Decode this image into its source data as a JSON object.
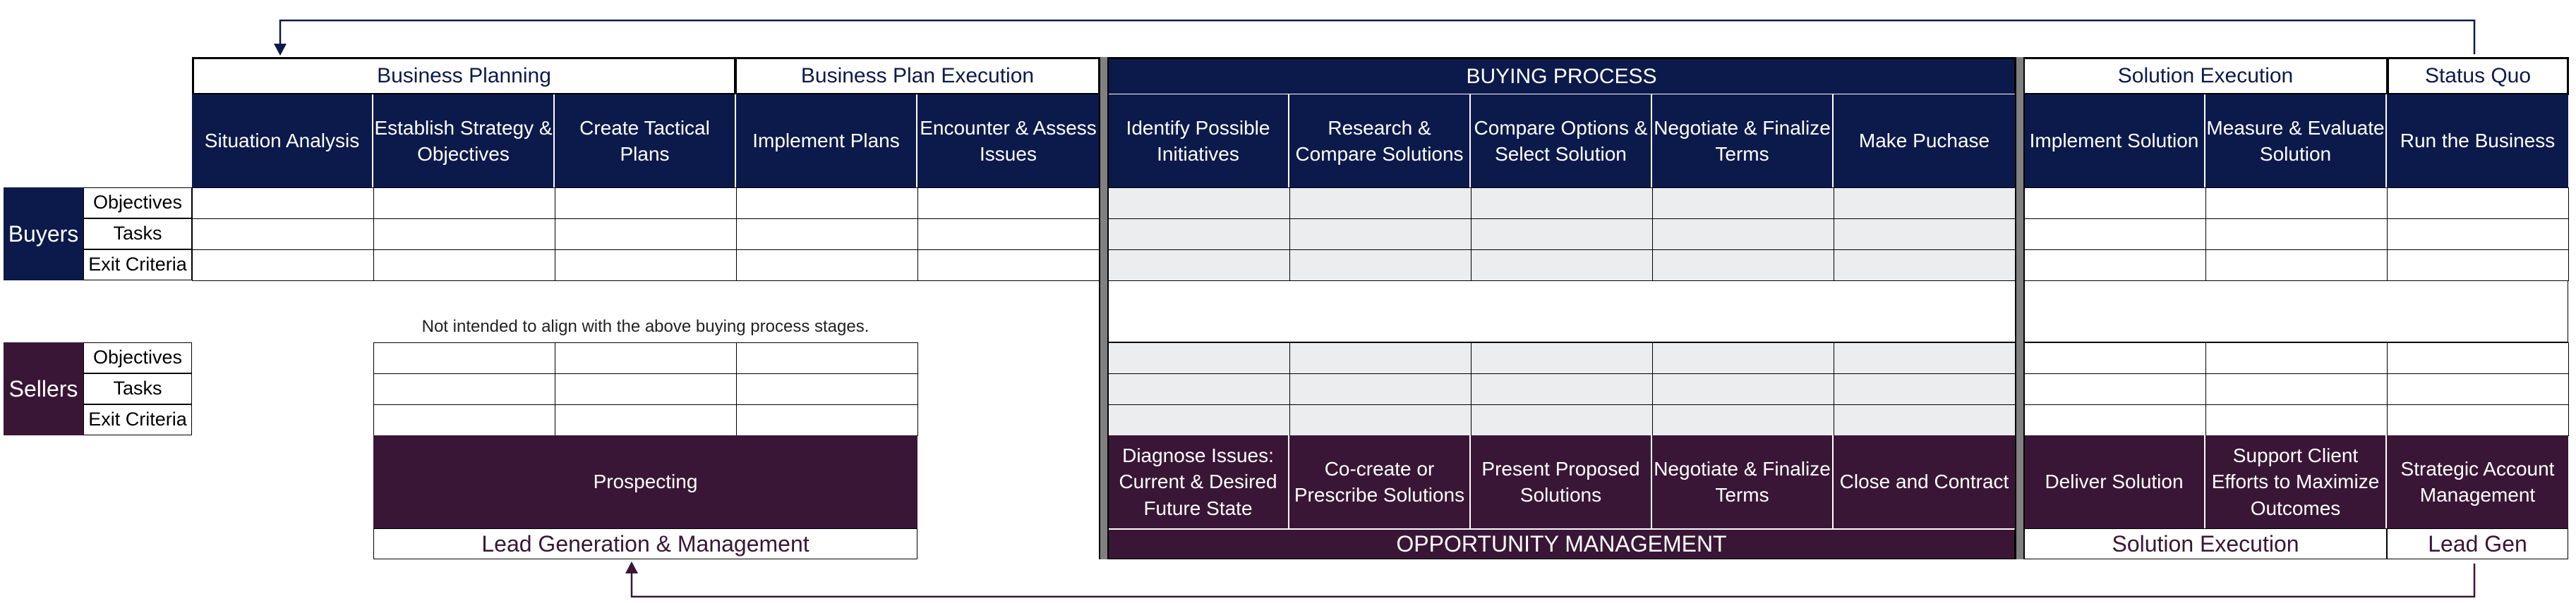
{
  "colors": {
    "navy": "#0c1a4b",
    "purple": "#3a1636",
    "separator_gray": "#808080",
    "shaded_cell": "#ecedef"
  },
  "phases": [
    {
      "label": "Business Planning"
    },
    {
      "label": "Business Plan Execution"
    },
    {
      "label": "BUYING PROCESS"
    },
    {
      "label": "Solution Execution"
    },
    {
      "label": "Status Quo"
    }
  ],
  "buyer_stages": [
    "Situation Analysis",
    "Establish Strategy & Objectives",
    "Create Tactical Plans",
    "Implement Plans",
    "Encounter & Assess Issues",
    "Identify Possible Initiatives",
    "Research & Compare Solutions",
    "Compare Options & Select Solution",
    "Negotiate & Finalize Terms",
    "Make Puchase",
    "Implement Solution",
    "Measure & Evaluate Solution",
    "Run the Business"
  ],
  "roles": {
    "buyers": "Buyers",
    "sellers": "Sellers"
  },
  "row_labels": [
    "Objectives",
    "Tasks",
    "Exit Criteria"
  ],
  "note": "Not intended to align with the above buying process stages.",
  "seller_stages": [
    "Prospecting",
    "Diagnose Issues: Current & Desired Future State",
    "Co-create or Prescribe Solutions",
    "Present Proposed Solutions",
    "Negotiate & Finalize Terms",
    "Close and Contract",
    "Deliver Solution",
    "Support Client Efforts to Maximize Outcomes",
    "Strategic Account Management"
  ],
  "seller_phases": [
    "Lead Generation & Management",
    "OPPORTUNITY MANAGEMENT",
    "Solution Execution",
    "Lead Gen"
  ],
  "arrows": [
    {
      "name": "status-quo-to-business-planning",
      "from": "Status Quo",
      "to": "Business Planning"
    },
    {
      "name": "lead-gen-to-lead-generation-management",
      "from": "Lead Gen",
      "to": "Lead Generation & Management"
    }
  ]
}
